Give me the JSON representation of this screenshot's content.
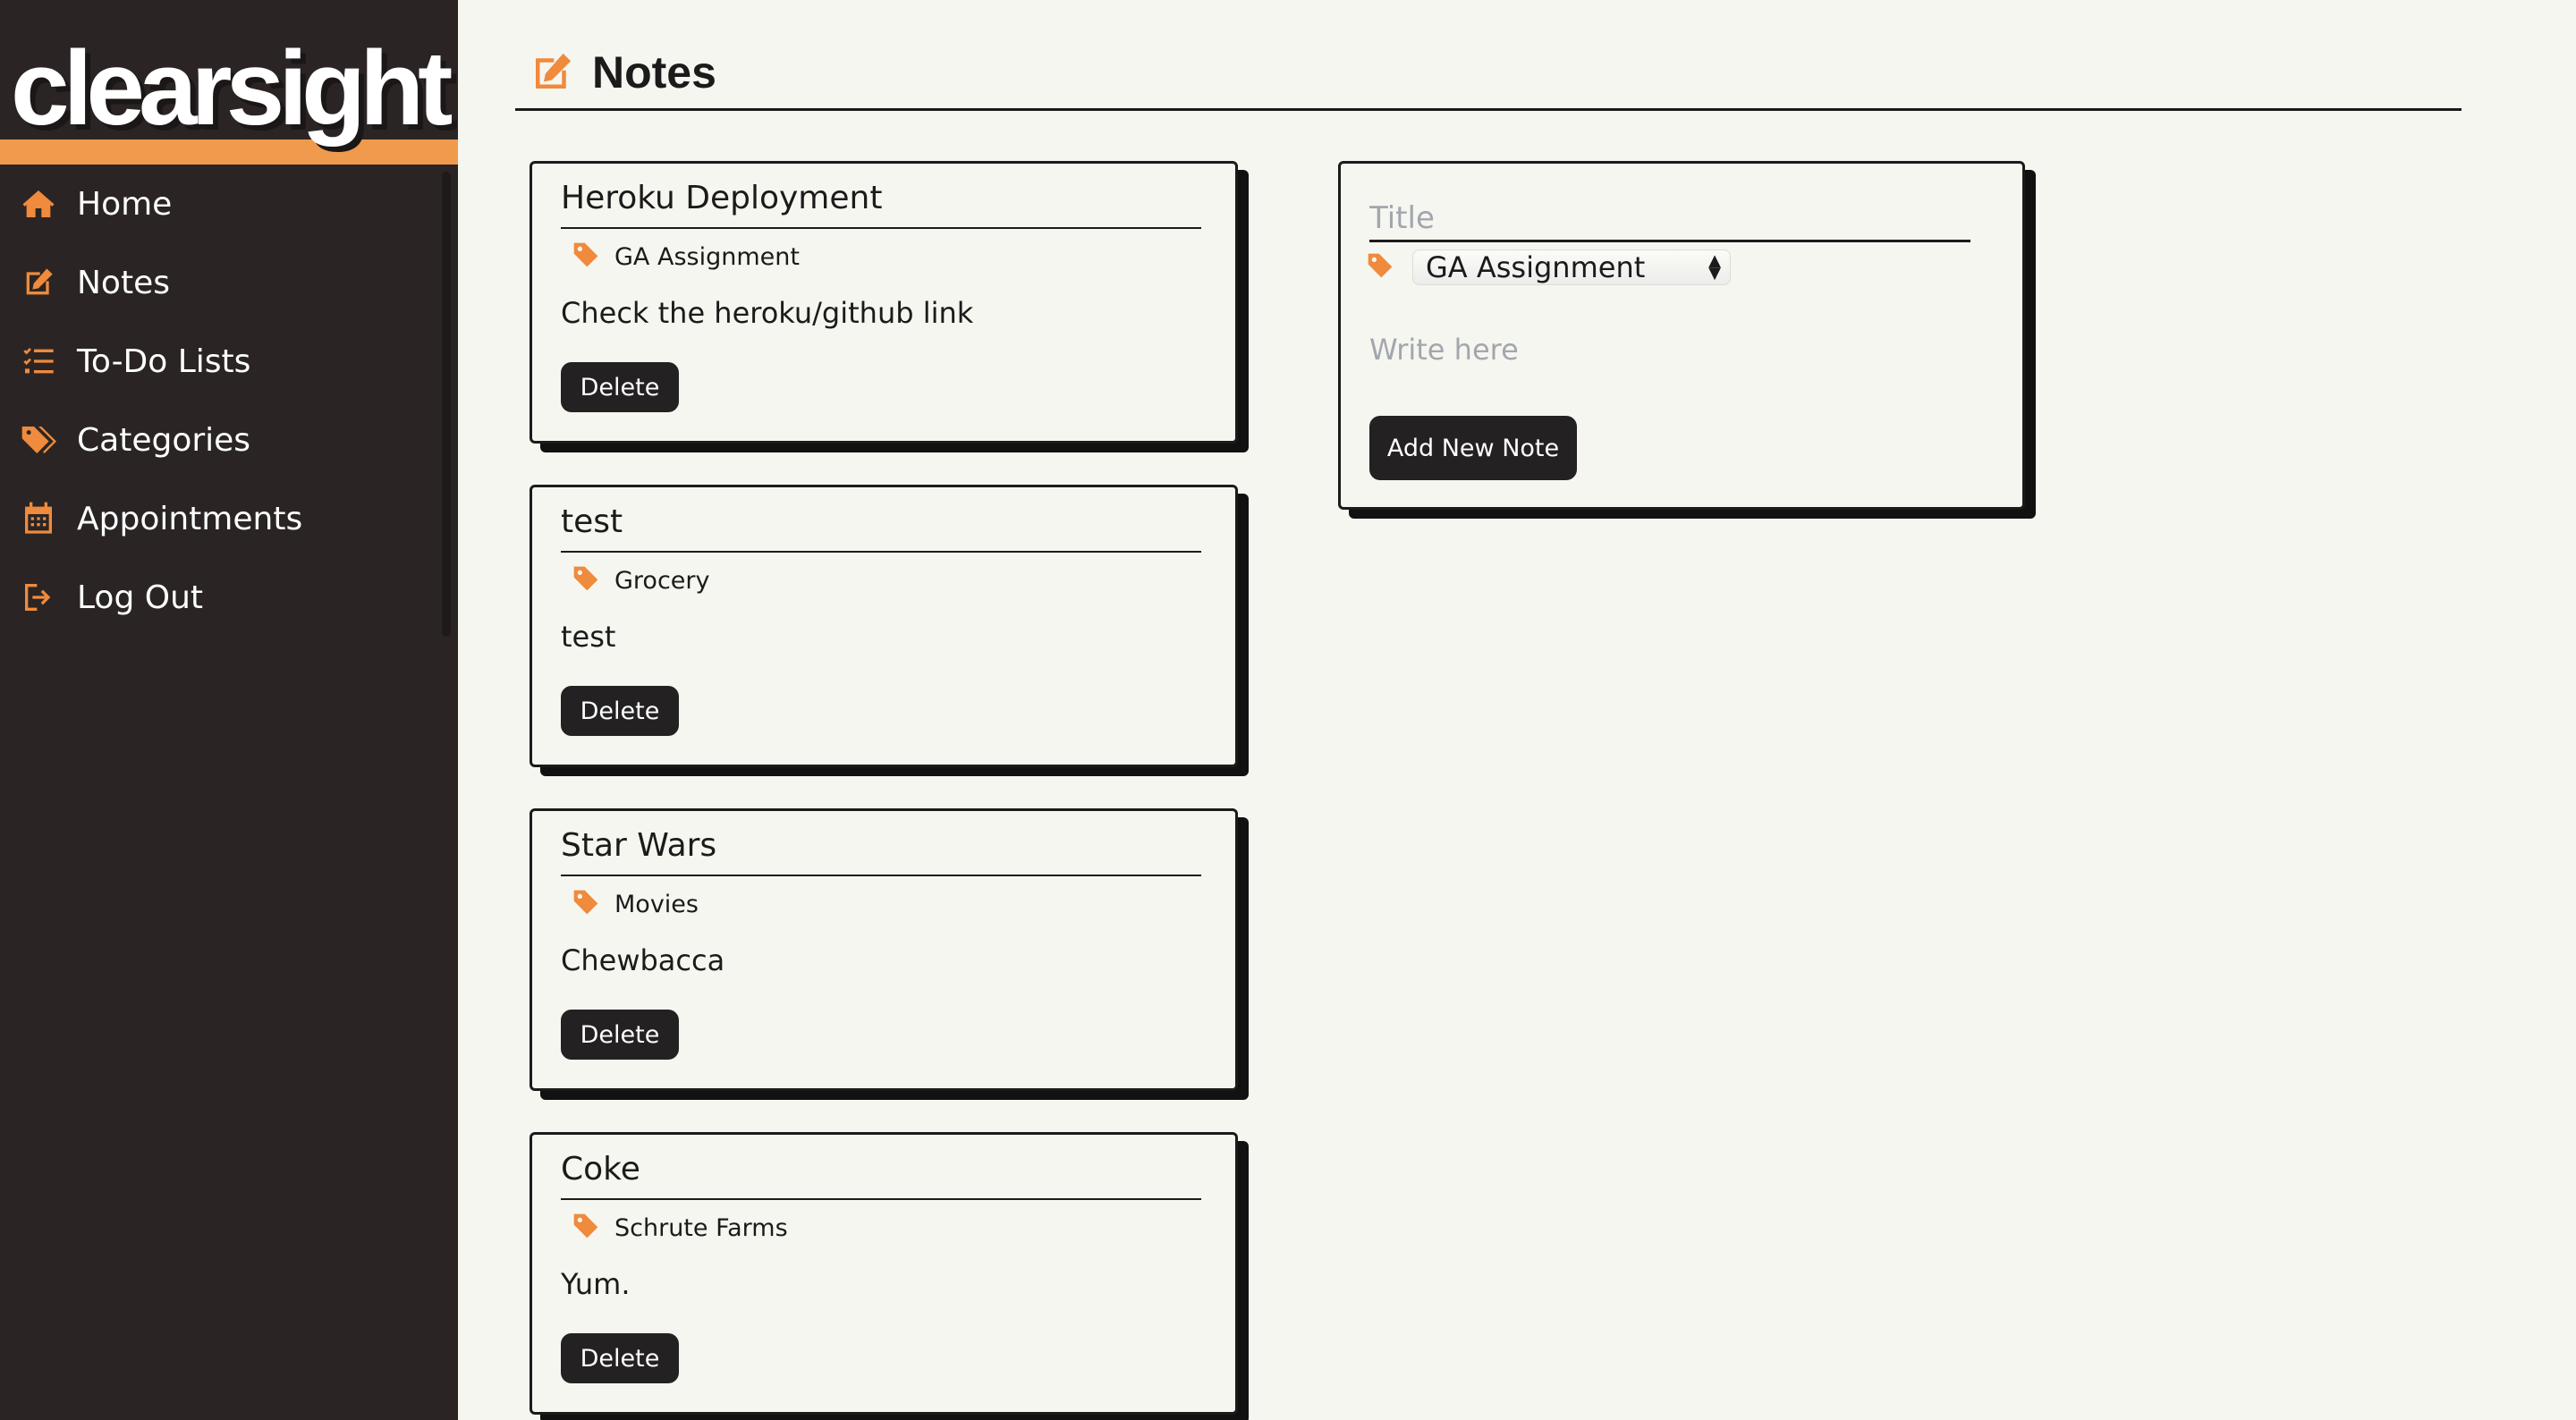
{
  "app": {
    "logo": "clearsight"
  },
  "colors": {
    "accent": "#f09a4d",
    "icon": "#f08a3c",
    "sidebar_bg": "#2a2524",
    "page_bg": "#f6f6f0"
  },
  "sidebar": {
    "items": [
      {
        "label": "Home",
        "icon": "home-icon"
      },
      {
        "label": "Notes",
        "icon": "edit-icon"
      },
      {
        "label": "To-Do Lists",
        "icon": "checklist-icon"
      },
      {
        "label": "Categories",
        "icon": "tags-icon"
      },
      {
        "label": "Appointments",
        "icon": "calendar-icon"
      },
      {
        "label": "Log Out",
        "icon": "logout-icon"
      }
    ]
  },
  "header": {
    "title": "Notes",
    "icon": "edit-icon"
  },
  "notes": [
    {
      "title": "Heroku Deployment",
      "category": "GA Assignment",
      "body": "Check the heroku/github link",
      "delete_label": "Delete"
    },
    {
      "title": "test",
      "category": "Grocery",
      "body": "test",
      "delete_label": "Delete"
    },
    {
      "title": "Star Wars",
      "category": "Movies",
      "body": "Chewbacca",
      "delete_label": "Delete"
    },
    {
      "title": "Coke",
      "category": "Schrute Farms",
      "body": "Yum.",
      "delete_label": "Delete"
    }
  ],
  "new_note": {
    "title_placeholder": "Title",
    "category_selected": "GA Assignment",
    "body_placeholder": "Write here",
    "add_label": "Add New Note"
  }
}
